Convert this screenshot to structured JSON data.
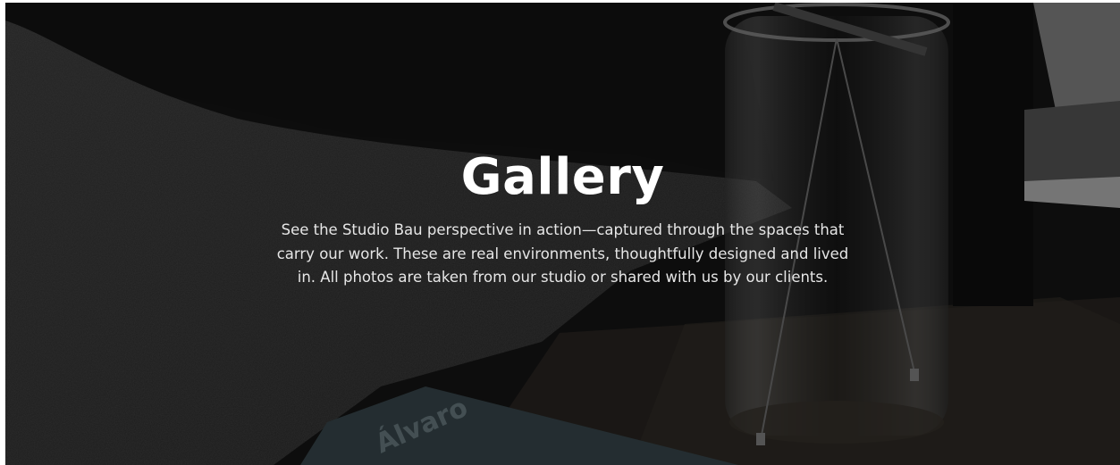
{
  "hero": {
    "title": "Gallery",
    "description": "See the Studio Bau perspective in action—captured through the spaces that carry our work. These are real environments, thoughtfully designed and lived in. All photos are taken from our studio or shared with us by our clients.",
    "background_image": "dark-interior-sofa-glass-lamp-photo",
    "book_cover_text": "Álvaro"
  },
  "colors": {
    "background": "#1c1c1c",
    "title": "#ffffff",
    "description": "#e6e6e6"
  }
}
